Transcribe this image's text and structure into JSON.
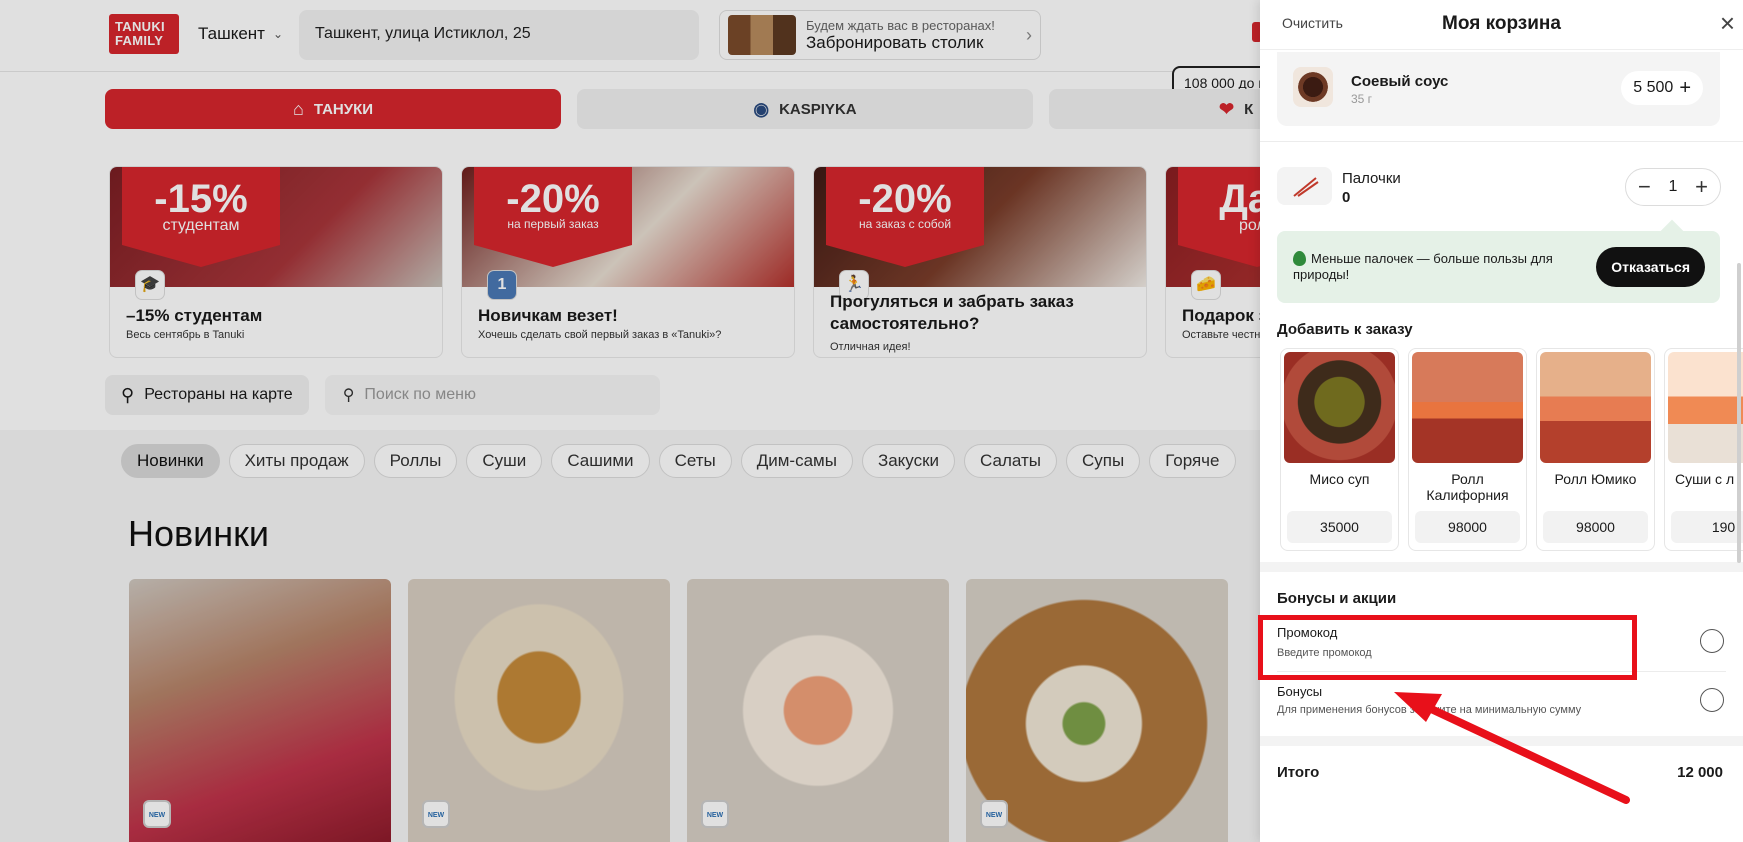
{
  "header": {
    "logo": "TANUKI FAMILY",
    "city": "Ташкент",
    "address": "Ташкент, улица Истиклол, 25",
    "booking_small": "Будем ждать вас в ресторанах!",
    "booking_big": "Забронировать столик",
    "min_order_tip": "108 000 до м"
  },
  "brands": [
    {
      "label": "ТАНУКИ",
      "icon": "tanuki-roof-icon"
    },
    {
      "label": "KASPIYKA",
      "icon": "kaspiyka-globe-icon"
    },
    {
      "label": "К",
      "icon": "heart-icon"
    }
  ],
  "promos": [
    {
      "pct": "-15%",
      "sub": "студентам",
      "title": "–15% студентам",
      "desc": "Весь сентябрь в Tanuki",
      "emoji": "🎓"
    },
    {
      "pct": "-20%",
      "sub": "на первый заказ",
      "title": "Новичкам везет!",
      "desc": "Хочешь сделать свой первый заказ в «Tanuki»?",
      "emoji": "1"
    },
    {
      "pct": "-20%",
      "sub": "на заказ с собой",
      "title": "Прогуляться и забрать заказ самостоятельно?",
      "desc": "Отличная идея!",
      "emoji": "🏃"
    },
    {
      "pct": "Дар",
      "sub": "ролл",
      "title": "Подарок з",
      "desc": "Оставьте честн",
      "emoji": "🧀"
    }
  ],
  "search": {
    "map_button": "Рестораны на карте",
    "placeholder": "Поиск по меню"
  },
  "categories": [
    "Новинки",
    "Хиты продаж",
    "Роллы",
    "Суши",
    "Сашими",
    "Сеты",
    "Дим-самы",
    "Закуски",
    "Салаты",
    "Супы",
    "Горяче"
  ],
  "section_title": "Новинки",
  "new_badge": "NEW",
  "cart": {
    "clear": "Очистить",
    "title": "Моя корзина",
    "sauce": {
      "name": "Соевый соус",
      "weight": "35 г",
      "price": "5 500"
    },
    "chopsticks": {
      "name": "Палочки",
      "count": "0",
      "qty": "1"
    },
    "eco_text": "Меньше палочек — больше пользы для природы!",
    "eco_button": "Отказаться",
    "add_title": "Добавить к заказу",
    "addons": [
      {
        "name": "Мисо суп",
        "price": "35000"
      },
      {
        "name": "Ролл Калифорния",
        "price": "98000"
      },
      {
        "name": "Ролл Юмико",
        "price": "98000"
      },
      {
        "name": "Суши с л",
        "price": "190"
      }
    ],
    "bonus_title": "Бонусы и акции",
    "promo_title": "Промокод",
    "promo_sub": "Введите промокод",
    "bonus_opt_title": "Бонусы",
    "bonus_opt_sub": "Для применения бонусов закажите на минимальную сумму",
    "total_label": "Итого",
    "total_value": "12 000"
  },
  "colors": {
    "brand_red": "#d7262d",
    "highlight_red": "#e8101a",
    "eco_green": "#e5f1e7"
  }
}
